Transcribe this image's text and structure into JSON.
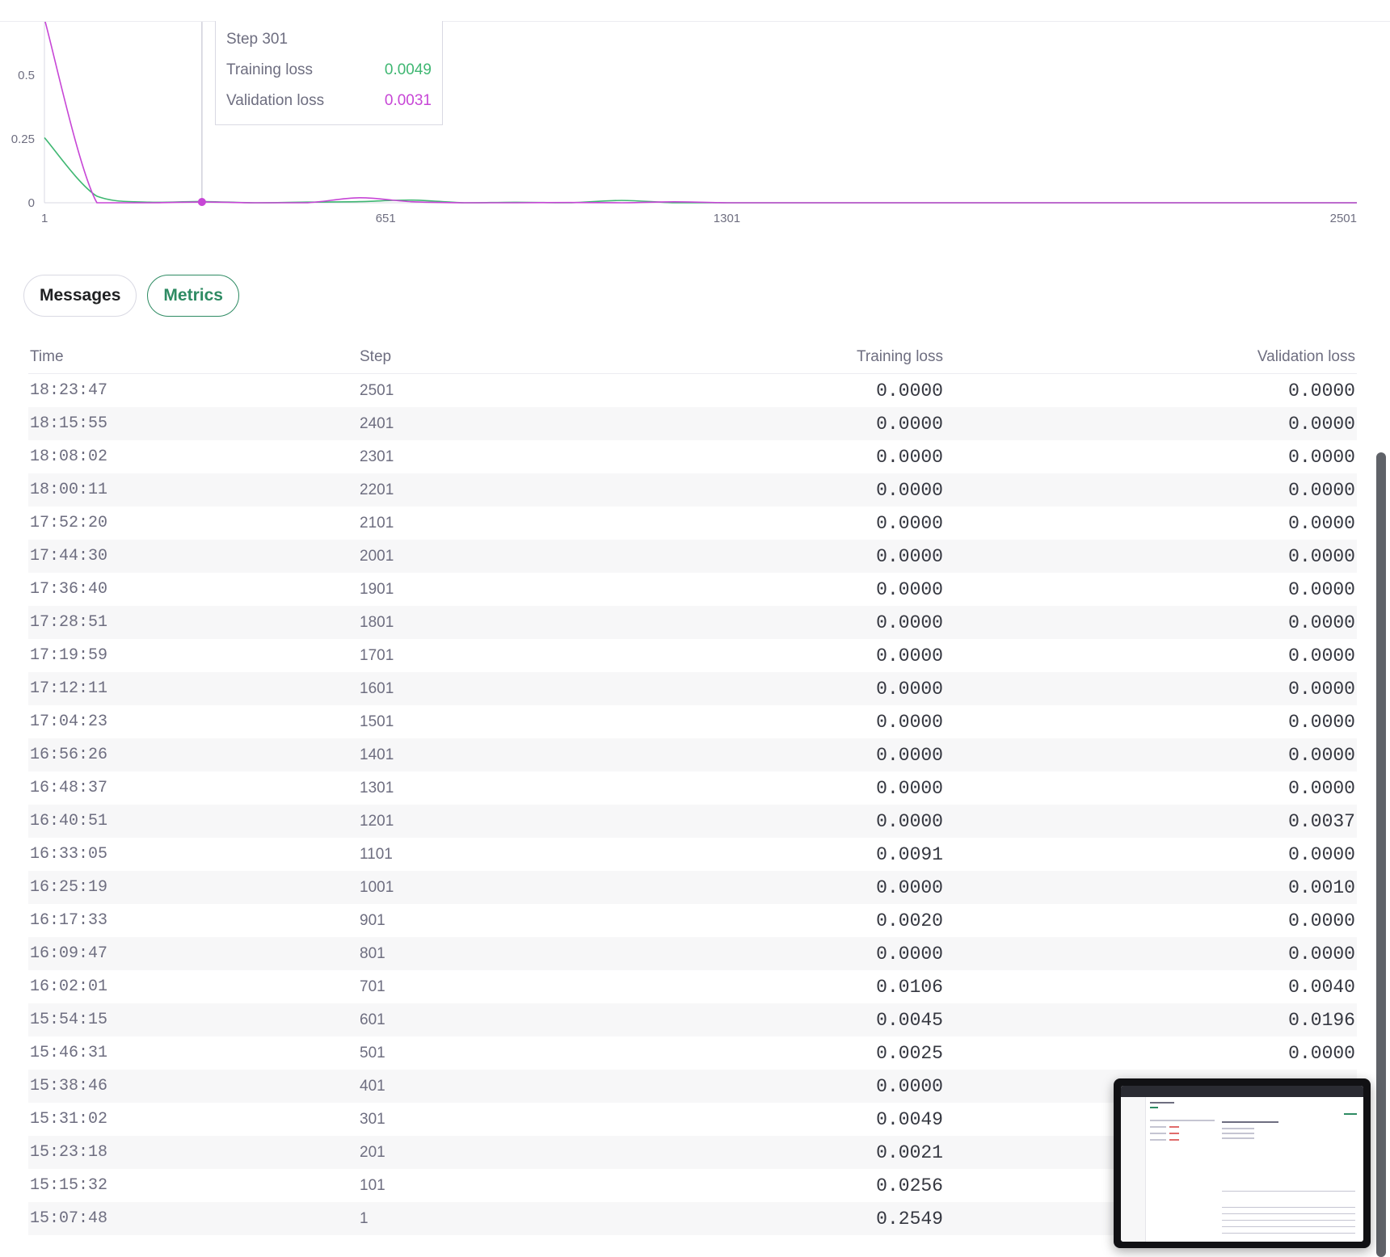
{
  "tooltip": {
    "step_label": "Step 301",
    "training_label": "Training loss",
    "training_value": "0.0049",
    "validation_label": "Validation loss",
    "validation_value": "0.0031"
  },
  "tabs": {
    "messages": "Messages",
    "metrics": "Metrics"
  },
  "table": {
    "headers": {
      "time": "Time",
      "step": "Step",
      "training_loss": "Training loss",
      "validation_loss": "Validation loss"
    },
    "rows": [
      {
        "time": "18:23:47",
        "step": "2501",
        "train": "0.0000",
        "val": "0.0000"
      },
      {
        "time": "18:15:55",
        "step": "2401",
        "train": "0.0000",
        "val": "0.0000"
      },
      {
        "time": "18:08:02",
        "step": "2301",
        "train": "0.0000",
        "val": "0.0000"
      },
      {
        "time": "18:00:11",
        "step": "2201",
        "train": "0.0000",
        "val": "0.0000"
      },
      {
        "time": "17:52:20",
        "step": "2101",
        "train": "0.0000",
        "val": "0.0000"
      },
      {
        "time": "17:44:30",
        "step": "2001",
        "train": "0.0000",
        "val": "0.0000"
      },
      {
        "time": "17:36:40",
        "step": "1901",
        "train": "0.0000",
        "val": "0.0000"
      },
      {
        "time": "17:28:51",
        "step": "1801",
        "train": "0.0000",
        "val": "0.0000"
      },
      {
        "time": "17:19:59",
        "step": "1701",
        "train": "0.0000",
        "val": "0.0000"
      },
      {
        "time": "17:12:11",
        "step": "1601",
        "train": "0.0000",
        "val": "0.0000"
      },
      {
        "time": "17:04:23",
        "step": "1501",
        "train": "0.0000",
        "val": "0.0000"
      },
      {
        "time": "16:56:26",
        "step": "1401",
        "train": "0.0000",
        "val": "0.0000"
      },
      {
        "time": "16:48:37",
        "step": "1301",
        "train": "0.0000",
        "val": "0.0000"
      },
      {
        "time": "16:40:51",
        "step": "1201",
        "train": "0.0000",
        "val": "0.0037"
      },
      {
        "time": "16:33:05",
        "step": "1101",
        "train": "0.0091",
        "val": "0.0000"
      },
      {
        "time": "16:25:19",
        "step": "1001",
        "train": "0.0000",
        "val": "0.0010"
      },
      {
        "time": "16:17:33",
        "step": "901",
        "train": "0.0020",
        "val": "0.0000"
      },
      {
        "time": "16:09:47",
        "step": "801",
        "train": "0.0000",
        "val": "0.0000"
      },
      {
        "time": "16:02:01",
        "step": "701",
        "train": "0.0106",
        "val": "0.0040"
      },
      {
        "time": "15:54:15",
        "step": "601",
        "train": "0.0045",
        "val": "0.0196"
      },
      {
        "time": "15:46:31",
        "step": "501",
        "train": "0.0025",
        "val": "0.0000"
      },
      {
        "time": "15:38:46",
        "step": "401",
        "train": "0.0000",
        "val": ""
      },
      {
        "time": "15:31:02",
        "step": "301",
        "train": "0.0049",
        "val": ""
      },
      {
        "time": "15:23:18",
        "step": "201",
        "train": "0.0021",
        "val": ""
      },
      {
        "time": "15:15:32",
        "step": "101",
        "train": "0.0256",
        "val": ""
      },
      {
        "time": "15:07:48",
        "step": "1",
        "train": "0.2549",
        "val": ""
      }
    ]
  },
  "chart_data": {
    "type": "line",
    "title": "",
    "xlabel": "",
    "ylabel": "",
    "xlim": [
      1,
      2501
    ],
    "ylim": [
      0,
      0.65
    ],
    "x_ticks": [
      "1",
      "651",
      "1301",
      "2501"
    ],
    "y_ticks": [
      "0",
      "0.25",
      "0.5"
    ],
    "grid": false,
    "series": [
      {
        "name": "Training loss",
        "color": "#3fb772",
        "x": [
          1,
          101,
          201,
          301,
          401,
          501,
          601,
          701,
          801,
          901,
          1001,
          1101,
          1201,
          1301,
          1401,
          1501,
          1601,
          1701,
          1801,
          1901,
          2001,
          2101,
          2201,
          2301,
          2401,
          2501
        ],
        "y": [
          0.2549,
          0.0256,
          0.0021,
          0.0049,
          0.0,
          0.0025,
          0.0045,
          0.0106,
          0.0,
          0.002,
          0.0,
          0.0091,
          0.0,
          0.0,
          0.0,
          0.0,
          0.0,
          0.0,
          0.0,
          0.0,
          0.0,
          0.0,
          0.0,
          0.0,
          0.0,
          0.0
        ]
      },
      {
        "name": "Validation loss",
        "color": "#c746d6",
        "x": [
          1,
          101,
          201,
          301,
          401,
          501,
          601,
          701,
          801,
          901,
          1001,
          1101,
          1201,
          1301,
          1401,
          1501,
          1601,
          1701,
          1801,
          1901,
          2001,
          2101,
          2201,
          2301,
          2401,
          2501
        ],
        "y": [
          0.72,
          0.0,
          0.0,
          0.0031,
          0.0,
          0.0,
          0.0196,
          0.004,
          0.0,
          0.0,
          0.001,
          0.0,
          0.0037,
          0.0,
          0.0,
          0.0,
          0.0,
          0.0,
          0.0,
          0.0,
          0.0,
          0.0,
          0.0,
          0.0,
          0.0,
          0.0
        ]
      }
    ],
    "hover": {
      "x": 301,
      "y": 0.0031,
      "color": "#c746d6"
    }
  }
}
